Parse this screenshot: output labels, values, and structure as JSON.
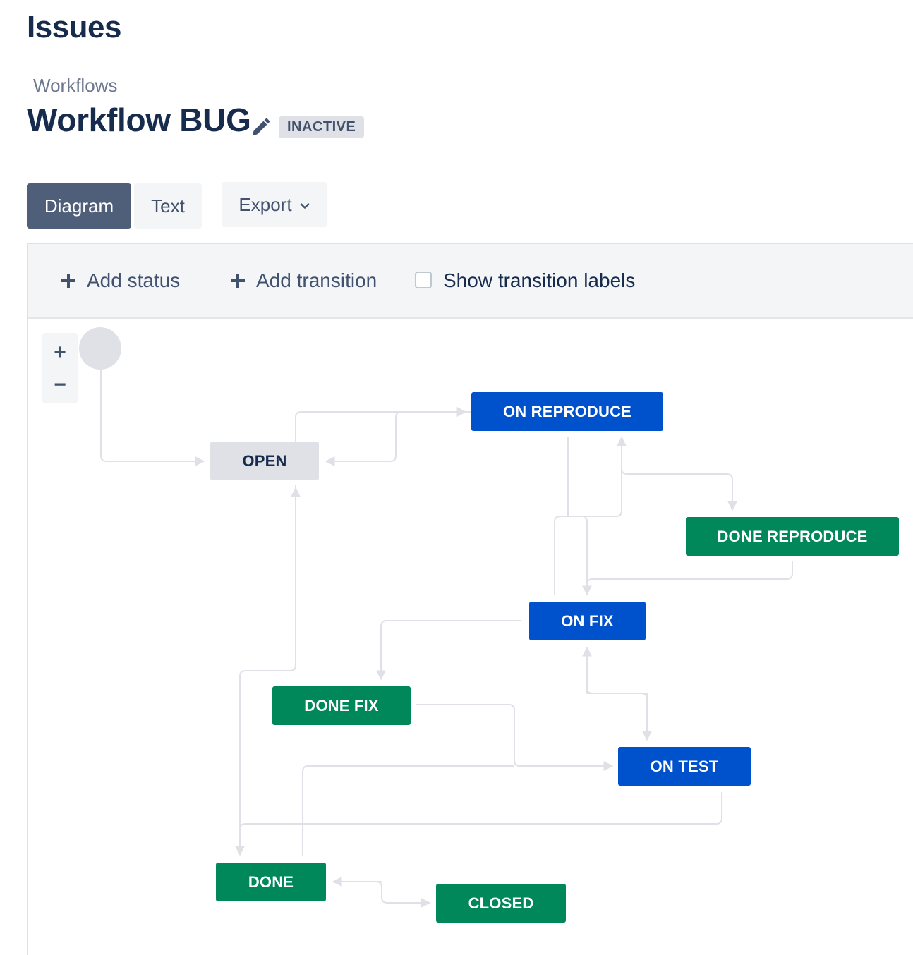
{
  "header": {
    "app_title": "Issues",
    "breadcrumb": "Workflows",
    "workflow_title": "Workflow BUG",
    "status_lozenge": "INACTIVE"
  },
  "view_tabs": {
    "diagram": "Diagram",
    "text": "Text",
    "export": "Export"
  },
  "toolbar": {
    "add_status": "Add status",
    "add_transition": "Add transition",
    "show_labels": "Show transition labels",
    "show_labels_checked": false
  },
  "zoom": {
    "in": "+",
    "out": "−"
  },
  "statuses": {
    "open": {
      "label": "OPEN",
      "category": "todo"
    },
    "on_reproduce": {
      "label": "ON REPRODUCE",
      "category": "in-progress"
    },
    "done_reproduce": {
      "label": "DONE REPRODUCE",
      "category": "done"
    },
    "on_fix": {
      "label": "ON FIX",
      "category": "in-progress"
    },
    "done_fix": {
      "label": "DONE FIX",
      "category": "done"
    },
    "on_test": {
      "label": "ON TEST",
      "category": "in-progress"
    },
    "done": {
      "label": "DONE",
      "category": "done"
    },
    "closed": {
      "label": "CLOSED",
      "category": "done"
    }
  },
  "colors": {
    "todo": "#dfe1e6",
    "in_progress": "#0052cc",
    "done": "#00875a",
    "connector": "#dfe1e6"
  }
}
